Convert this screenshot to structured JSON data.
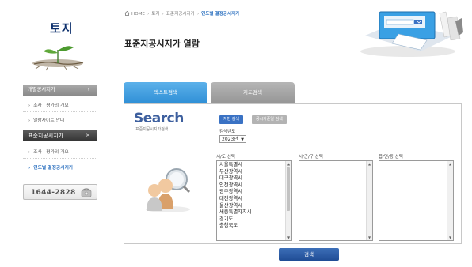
{
  "sidebar": {
    "brand": "토지",
    "menu1": {
      "label": "개별공시지가",
      "arrow": "›"
    },
    "menu1_items": [
      "조사 · 평가의 개요",
      "열람사이트 안내"
    ],
    "menu2": {
      "label": "표준지공시지가",
      "arrow": ">"
    },
    "menu2_items": [
      "조사 · 평가의 개요",
      "연도별 결정공시지가"
    ],
    "phone": "1644-2828"
  },
  "breadcrumb": {
    "home": "HOME",
    "items": [
      "토지",
      "표준지공시지가"
    ],
    "current": "연도별 결정공시지가"
  },
  "page_title": "표준지공시지가 열람",
  "tabs": [
    "텍스트검색",
    "지도검색"
  ],
  "search": {
    "logo": "Search",
    "sub": "표준지공시지가검색",
    "btn_address": "지번 검색",
    "btn_road": "공시가준일 검색",
    "year_label": "검색년도",
    "year_value": "2023년",
    "col_sido": "시/도 선택",
    "col_sigungu": "시/군/구 선택",
    "col_eup": "읍/면/동 선택",
    "sido_options": [
      "서울특별시",
      "부산광역시",
      "대구광역시",
      "인천광역시",
      "광주광역시",
      "대전광역시",
      "울산광역시",
      "세종특별자치시",
      "경기도",
      "충청북도"
    ],
    "submit": "검색"
  },
  "colors": {
    "accent": "#2f8fd6",
    "navy": "#1f4c95",
    "brand": "#0b2e6b"
  }
}
